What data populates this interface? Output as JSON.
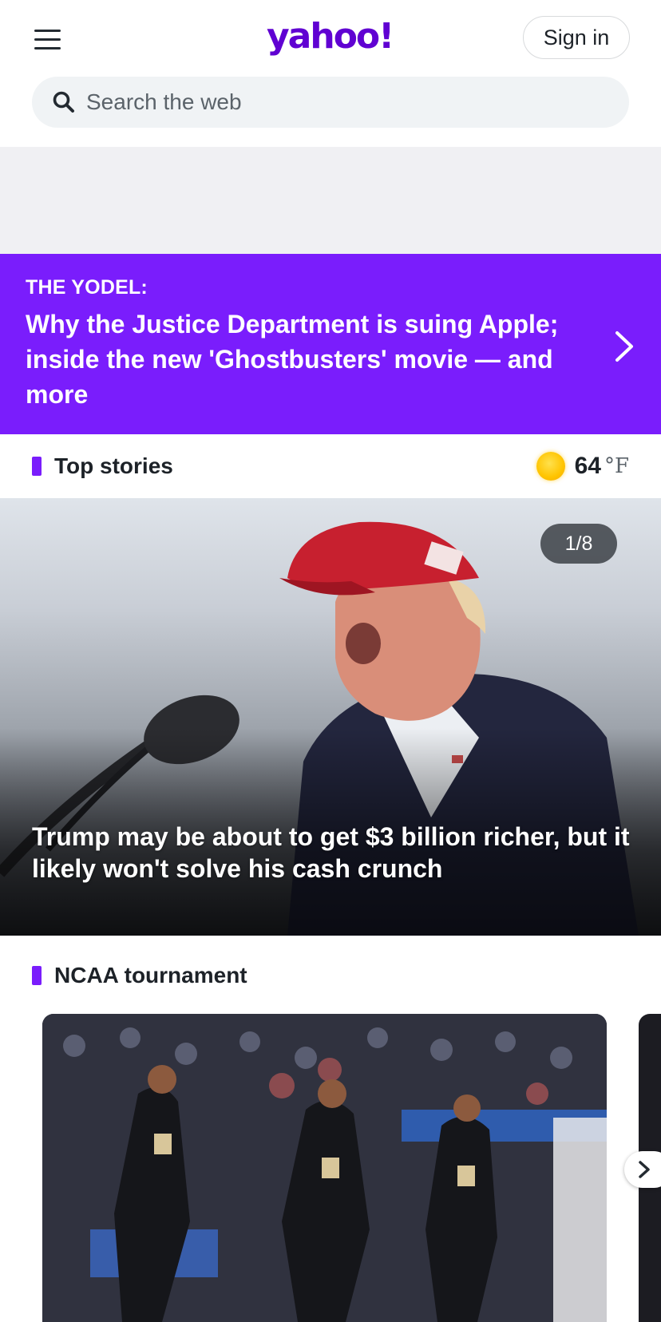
{
  "header": {
    "logo_text": "yahoo!",
    "signin_label": "Sign in",
    "search_placeholder": "Search the web",
    "brand_color": "#6001d2"
  },
  "yodel": {
    "kicker": "THE YODEL:",
    "headline": "Why the Justice Department is suing Apple; inside the new 'Ghostbusters' movie — and more",
    "background_color": "#7a1dfc"
  },
  "top_stories": {
    "title": "Top stories",
    "weather": {
      "temperature": "64",
      "unit": "°F",
      "icon": "sun-icon"
    },
    "hero": {
      "counter": "1/8",
      "headline": "Trump may be about to get $3 billion richer, but it likely won't solve his cash crunch"
    }
  },
  "ncaa": {
    "title": "NCAA tournament"
  },
  "icons": {
    "menu": "hamburger-menu-icon",
    "search": "search-icon",
    "yodel_next": "chevron-right-icon",
    "carousel_next": "chevron-right-icon"
  }
}
